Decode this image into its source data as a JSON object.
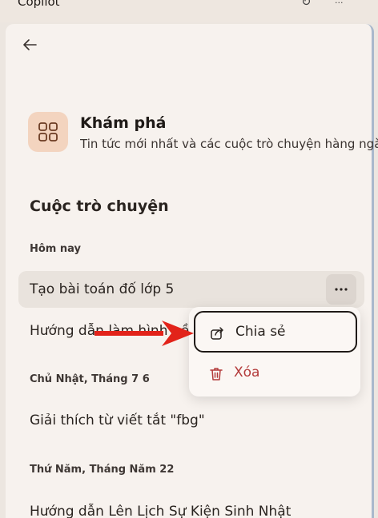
{
  "window": {
    "title": "Copilot",
    "refresh_glyph": "↻",
    "more_glyph": "···"
  },
  "discover": {
    "title": "Khám phá",
    "subtitle": "Tin tức mới nhất và các cuộc trò chuyện hàng ngày của bạn"
  },
  "conversations": {
    "title": "Cuộc trò chuyện",
    "groups": [
      {
        "label": "Hôm nay",
        "items": [
          "Tạo bài toán đố lớp 5",
          "Hướng dẫn làm hình nền"
        ]
      },
      {
        "label": "Chủ Nhật, Tháng 7 6",
        "items": [
          "Giải thích từ viết tắt \"fbg\""
        ]
      },
      {
        "label": "Thứ Năm, Tháng Năm 22",
        "items": [
          "Hướng dẫn Lên Lịch Sự Kiện Sinh Nhật"
        ]
      }
    ]
  },
  "context_menu": {
    "share_label": "Chia sẻ",
    "delete_label": "Xóa"
  },
  "colors": {
    "accent_icon_bg": "#f3d4bf",
    "delete_red": "#b33a3a",
    "annotation_arrow": "#e2231a"
  }
}
